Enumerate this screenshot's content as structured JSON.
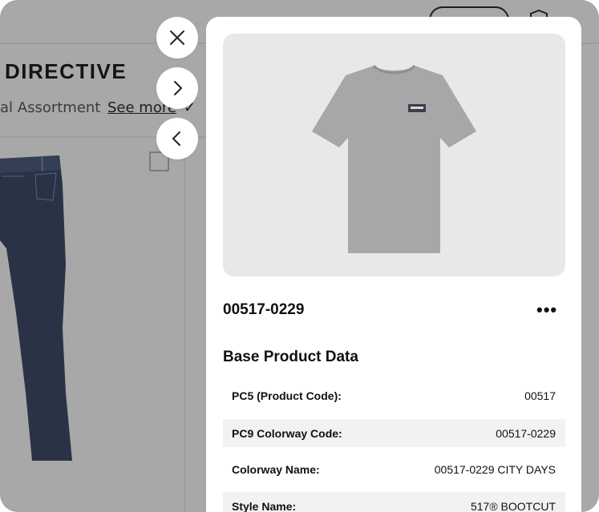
{
  "background": {
    "title": "DIRECTIVE",
    "subtitle": "al Assortment",
    "see_more": "See more",
    "check_mark": "✓",
    "close_icon": "close-icon",
    "next_icon": "chevron-right-icon",
    "prev_icon": "chevron-left-icon"
  },
  "panel": {
    "product_code": "00517-0229",
    "more_icon": "•••",
    "section_title": "Base Product Data",
    "rows": [
      {
        "label": "PC5 (Product Code):",
        "value": "00517"
      },
      {
        "label": "PC9 Colorway Code:",
        "value": "00517-0229"
      },
      {
        "label": "Colorway Name:",
        "value": "00517-0229 CITY DAYS"
      },
      {
        "label": "Style Name:",
        "value": "517® BOOTCUT"
      }
    ]
  },
  "colors": {
    "overlay": "#a8a8a8",
    "panel": "#ffffff",
    "image_bg": "#e8e8e8",
    "row_shade": "#f2f2f2",
    "tshirt": "#a7a7a7",
    "jeans": "#2a3346"
  }
}
